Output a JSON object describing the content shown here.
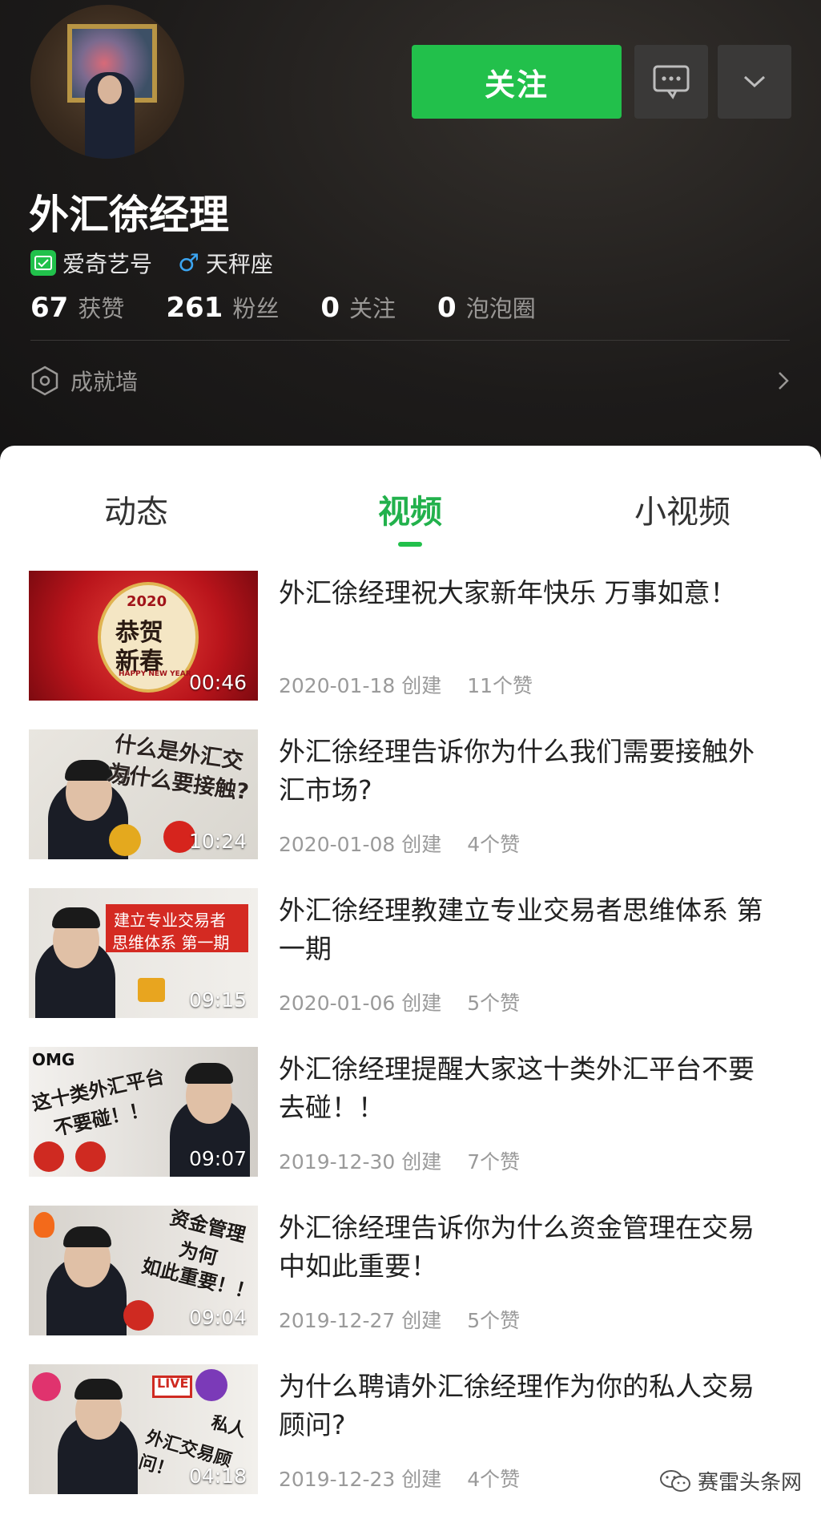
{
  "profile": {
    "follow_label": "关注",
    "username": "外汇徐经理",
    "badge_label": "爱奇艺号",
    "zodiac": "天秤座",
    "stats": [
      {
        "value": "67",
        "label": "获赞"
      },
      {
        "value": "261",
        "label": "粉丝"
      },
      {
        "value": "0",
        "label": "关注"
      },
      {
        "value": "0",
        "label": "泡泡圈"
      }
    ],
    "achievement_label": "成就墙"
  },
  "tabs": [
    "动态",
    "视频",
    "小视频"
  ],
  "active_tab": "视频",
  "videos": [
    {
      "title": "外汇徐经理祝大家新年快乐 万事如意！",
      "duration": "00:46",
      "date": "2020-01-18 创建",
      "likes": "11个赞"
    },
    {
      "title": "外汇徐经理告诉你为什么我们需要接触外汇市场?",
      "duration": "10:24",
      "date": "2020-01-08 创建",
      "likes": "4个赞"
    },
    {
      "title": "外汇徐经理教建立专业交易者思维体系 第一期",
      "duration": "09:15",
      "date": "2020-01-06 创建",
      "likes": "5个赞"
    },
    {
      "title": "外汇徐经理提醒大家这十类外汇平台不要去碰！！",
      "duration": "09:07",
      "date": "2019-12-30 创建",
      "likes": "7个赞"
    },
    {
      "title": "外汇徐经理告诉你为什么资金管理在交易中如此重要！",
      "duration": "09:04",
      "date": "2019-12-27 创建",
      "likes": "5个赞"
    },
    {
      "title": "为什么聘请外汇徐经理作为你的私人交易顾问?",
      "duration": "04:18",
      "date": "2019-12-23 创建",
      "likes": "4个赞"
    }
  ],
  "thumb_text": {
    "t1_year": "2020",
    "t1_line1": "恭贺",
    "t1_line2": "新春",
    "t1_en": "HAPPY NEW YEAR",
    "t2_line1": "什么是外汇交易",
    "t2_line2": "为什么要接触?",
    "t3_line1": "建立专业交易者",
    "t3_line2": "思维体系 第一期",
    "t4_omg": "OMG",
    "t4_line1": "这十类外汇平台",
    "t4_line2": "不要碰！！",
    "t5_line1": "资金管理",
    "t5_line2": "为何",
    "t5_line3": "如此重要！！",
    "t6_live": "LIVE",
    "t6_line1": "私人",
    "t6_line2": "外汇交易顾问！"
  },
  "watermark": "赛雷头条网",
  "colors": {
    "accent": "#22c04b",
    "header_bg": "#1d1b1a"
  }
}
